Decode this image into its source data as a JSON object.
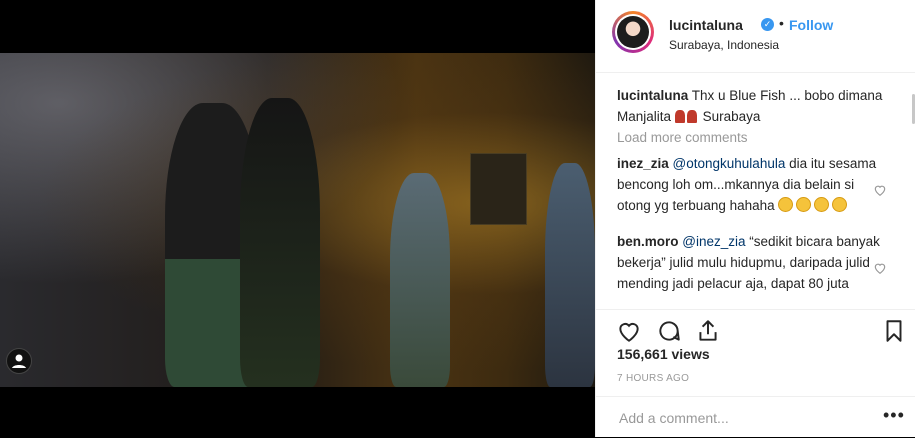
{
  "post": {
    "username": "lucintaluna",
    "verified_icon": "verified-badge-icon",
    "separator": "•",
    "follow_label": "Follow",
    "location": "Surabaya, Indonesia"
  },
  "caption": {
    "username": "lucintaluna",
    "text_before": "Thx u Blue Fish ... bobo dimana Manjalita",
    "text_after": "Surabaya"
  },
  "load_more": "Load more comments",
  "comments": [
    {
      "username": "inez_zia",
      "mention": "@otongkuhulahula",
      "text": "dia itu sesama bencong loh om...mkannya dia belain si otong yg terbuang hahaha"
    },
    {
      "username": "ben.moro",
      "mention": "@inez_zia",
      "text": "“sedikit bicara banyak bekerja” julid mulu hidupmu, daripada julid mending jadi pelacur aja, dapat 80 juta"
    }
  ],
  "stats": {
    "views": "156,661 views",
    "time": "7 HOURS AGO"
  },
  "add_comment": {
    "placeholder": "Add a comment..."
  },
  "more_label": "•••",
  "colors": {
    "link_blue": "#3897f0",
    "text": "#262626",
    "muted": "#999999"
  }
}
